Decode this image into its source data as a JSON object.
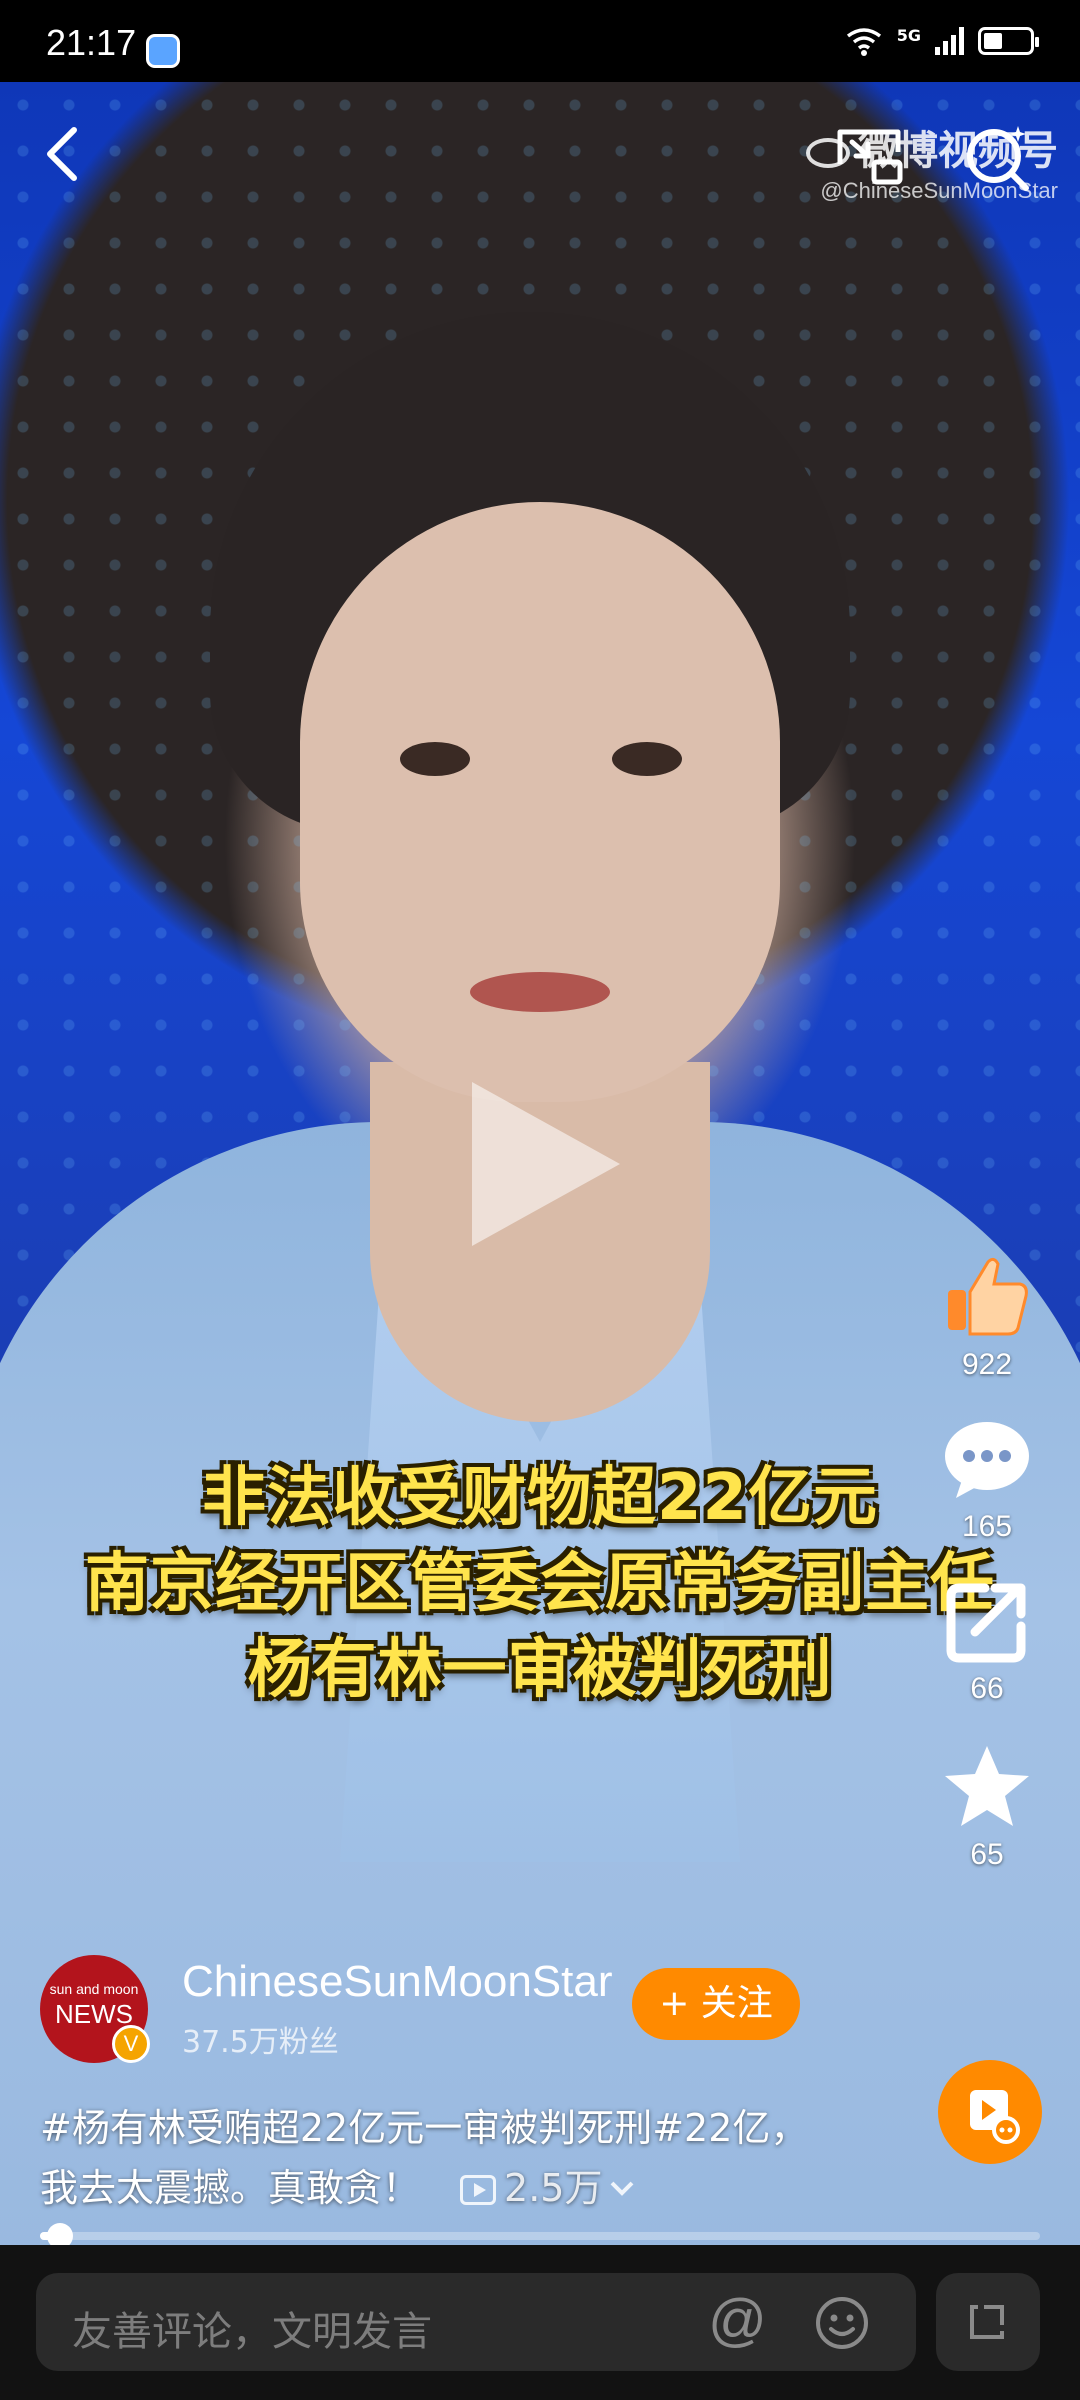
{
  "status_bar": {
    "time": "21:17",
    "network": "5G",
    "battery_percent": 40
  },
  "watermark": {
    "brand": "微博视频号",
    "handle": "@ChineseSunMoonStar"
  },
  "caption": {
    "line1": "非法收受财物超22亿元",
    "line2": "南京经开区管委会原常务副主任",
    "line3": "杨有林一审被判死刑"
  },
  "actions": {
    "like_count": "922",
    "comment_count": "165",
    "share_count": "66",
    "favorite_count": "65"
  },
  "author": {
    "avatar_text_top": "sun and moon",
    "avatar_text": "NEWS",
    "verified_badge": "V",
    "name": "ChineseSunMoonStar",
    "fans": "37.5万粉丝",
    "follow_label": "+ 关注"
  },
  "description": {
    "text": "#杨有林受贿超22亿元一审被判死刑#22亿，我去太震撼。真敢贪！",
    "views": "2.5万"
  },
  "progress": {
    "fraction": 0.02
  },
  "comment_bar": {
    "placeholder": "友善评论，文明发言",
    "at_symbol": "@"
  },
  "colors": {
    "accent": "#ff8a00",
    "caption_yellow": "#ffe44d",
    "background": "#000000"
  },
  "icons": [
    "back-icon",
    "pip-icon",
    "search-icon",
    "like-icon",
    "comment-icon",
    "share-icon",
    "star-icon",
    "chevron-down-icon",
    "emoji-icon",
    "expand-icon",
    "play-icon",
    "wifi-icon",
    "battery-icon"
  ]
}
